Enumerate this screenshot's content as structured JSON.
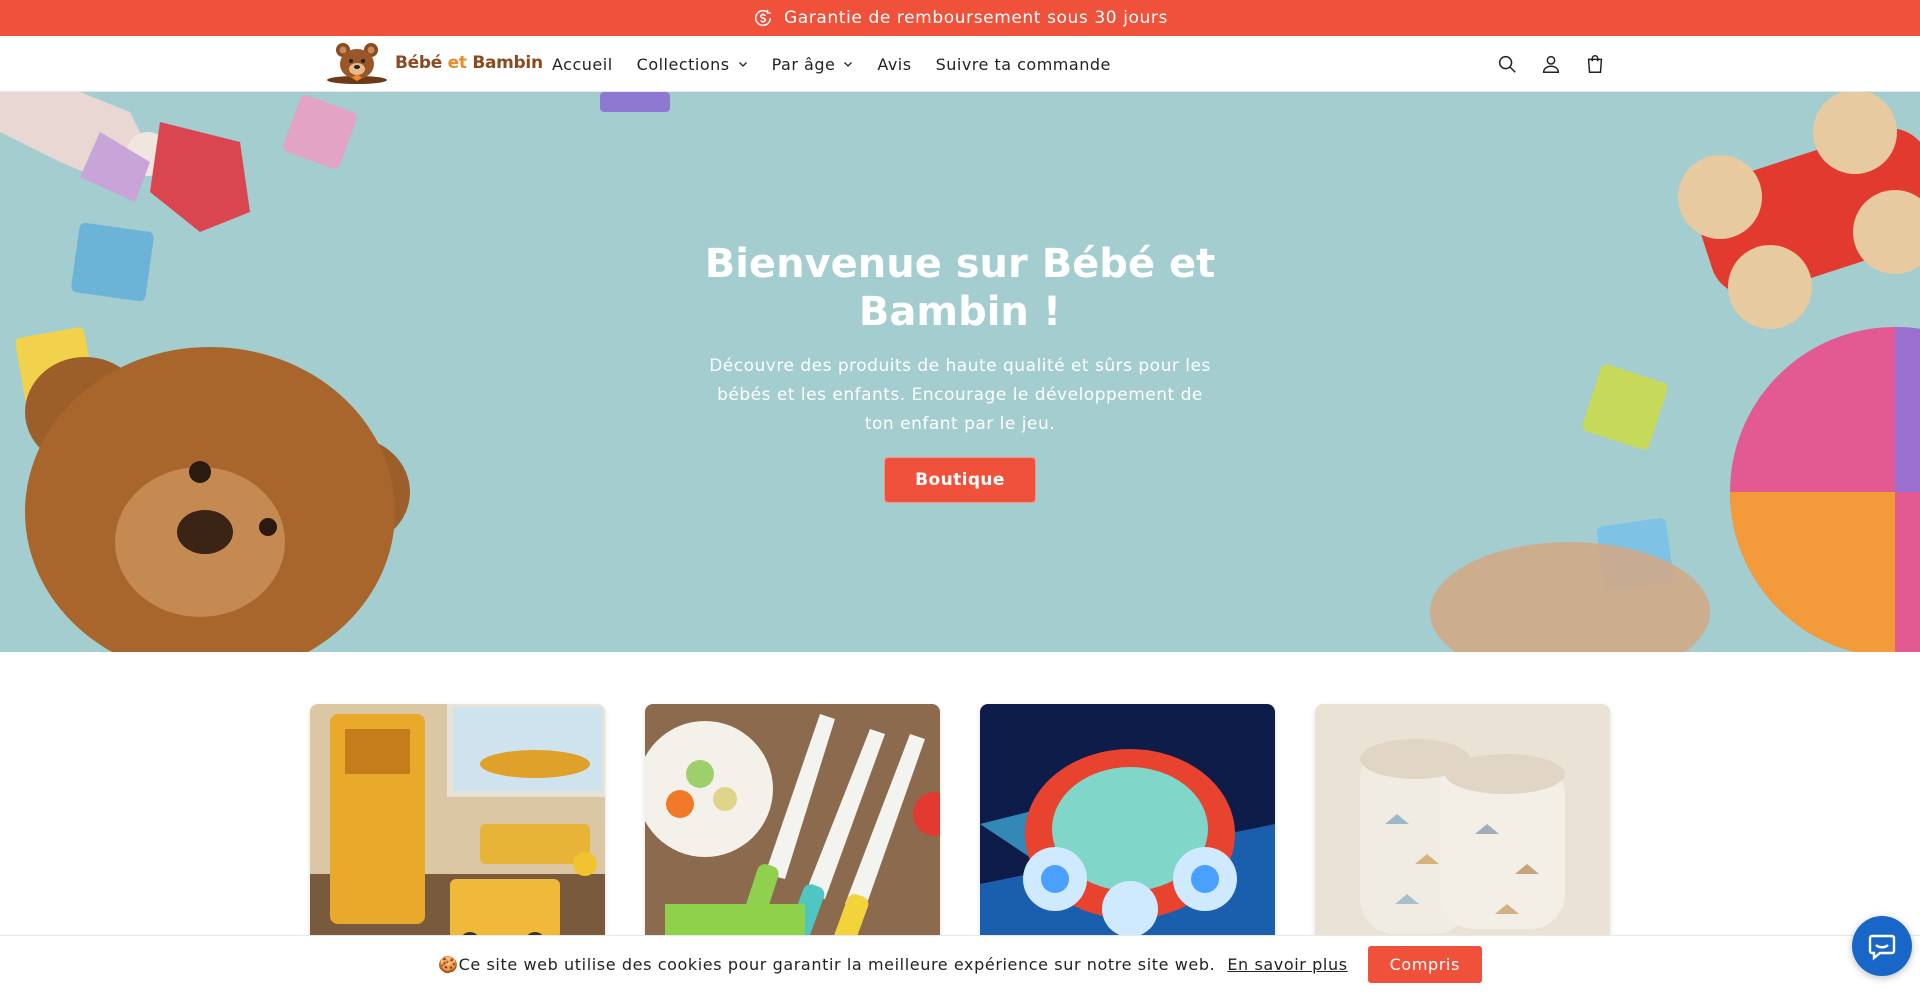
{
  "announcement": {
    "text": "Garantie de remboursement sous 30 jours",
    "icon": "money-back-icon"
  },
  "header": {
    "logo": {
      "name_part1": "Bébé",
      "name_part2": "et",
      "name_part3": "Bambin",
      "icon": "teddy-bear-logo-icon"
    },
    "nav": [
      {
        "label": "Accueil",
        "has_dropdown": false
      },
      {
        "label": "Collections",
        "has_dropdown": true
      },
      {
        "label": "Par âge",
        "has_dropdown": true
      },
      {
        "label": "Avis",
        "has_dropdown": false
      },
      {
        "label": "Suivre ta commande",
        "has_dropdown": false
      }
    ],
    "icons": [
      "search-icon",
      "account-icon",
      "cart-icon"
    ]
  },
  "hero": {
    "title": "Bienvenue sur Bébé et Bambin !",
    "text": "Découvre des produits de haute qualité et sûrs pour les bébés et les enfants. Encourage le développement de ton enfant par le jeu.",
    "button_label": "Boutique"
  },
  "products": [
    {
      "image": "construction-toys-image"
    },
    {
      "image": "kids-knives-image"
    },
    {
      "image": "stunt-car-image"
    },
    {
      "image": "baby-booties-image"
    }
  ],
  "cookie": {
    "icon": "🍪",
    "text": "Ce site web utilise des cookies pour garantir la meilleure expérience sur notre site web.",
    "more_label": "En savoir plus",
    "accept_label": "Compris"
  },
  "chat": {
    "icon": "chat-icon"
  },
  "colors": {
    "accent": "#ef513a",
    "hero_bg": "#a3cdce",
    "chat": "#1766c8"
  }
}
